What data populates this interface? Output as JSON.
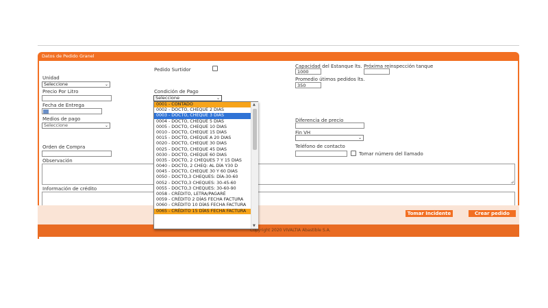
{
  "form": {
    "title": "Datos de Pedido Granel",
    "pedido_surtidor_label": "Pedido Surtidor",
    "unidad_label": "Unidad",
    "unidad_value": "Seleccione",
    "precio_label": "Precio Por Litro",
    "condicion_label": "Condición de Pago",
    "condicion_value": "Seleccione",
    "fecha_label": "Fecha de Entrega",
    "medios_label": "Medios de pago",
    "medios_value": "Seleccione",
    "orden_label": "Orden de Compra",
    "capacidad_label": "Capacidad del Estanque lts.",
    "capacidad_value": "1000",
    "reinspeccion_label": "Próxima reinspección tanque",
    "promedio_label": "Promedio útimos pedidos lts.",
    "promedio_value": "350",
    "diferencia_label": "Diferencia de precio",
    "finvh_label": "Fin VH",
    "telefono_label": "Teléfono de contacto",
    "tomar_numero_label": "Tomar número del llamado",
    "observacion_label": "Observación",
    "credito_label": "Información de crédito"
  },
  "buttons": {
    "tomar_incidente": "Tomar Incidente",
    "crear_pedido": "Crear pedido"
  },
  "footer_text": "Copyright 2020 VIVALTIA Abastible S.A.",
  "dropdown": {
    "options": [
      "0001 - CONTADO",
      "0002 - DOCTO, CHEQUE 2 DIAS",
      "0003 - DOCTO, CHEQUE 3 DIAS",
      "0004 - DOCTO, CHEQUE 5 DIAS",
      "0005 - DOCTO, CHEQUE 10 DIAS",
      "0010 - DOCTO, CHEQUE 15 DIAS",
      "0015 - DOCTO, CHEQUE A 20 DIAS",
      "0020 - DOCTO, CHEQUE 30 DIAS",
      "0025 - DOCTO, CHEQUE 45 DIAS",
      "0030 - DOCTO, CHEQUE 60 DIAS",
      "0035 - DOCTO, 2 CHEQUES 7 Y 15 DIAS",
      "0040 - DOCTO, 2 CHEQ: AL DÍA Y30 D",
      "0045 - DOCTO, CHEQUE 30 Y 60 DIAS",
      "0050 - DOCTO,3 CHEQUES: DÍA-30-60",
      "0052 - DOCTO,3 CHEQUES: 30-45-60",
      "0055 - DOCTO,3 CHEQUES: 30-60-90",
      "0058 - CRÉDITO, LETRA/PAGARÉ",
      "0059 - CRÉDITO 2 DÍAS FECHA FACTURA",
      "0060 - CRÉDITO 10 DÍAS FECHA FACTURA",
      "0065 - CRÉDITO 15 DÍAS FECHA FACTURA"
    ],
    "highlighted_index": 2
  }
}
